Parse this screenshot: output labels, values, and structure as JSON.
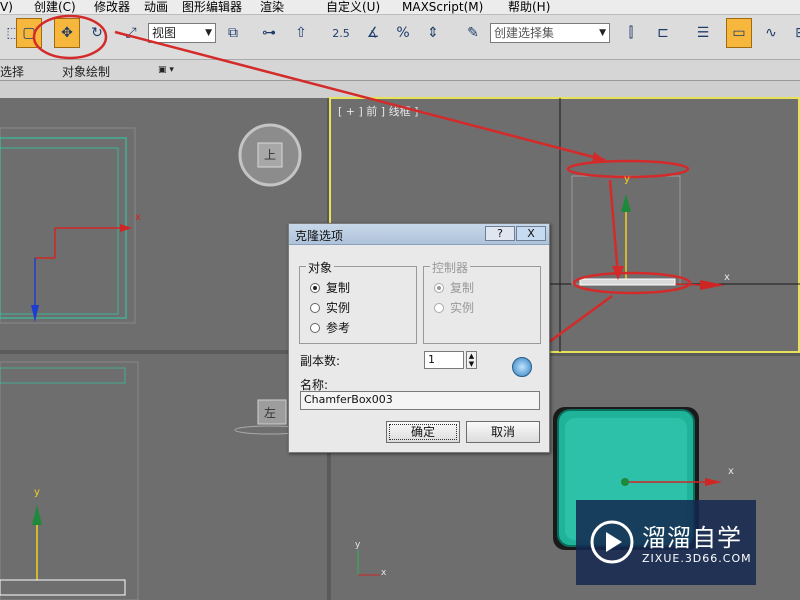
{
  "menu": {
    "items": [
      "V)",
      "创建(C)",
      "修改器",
      "动画",
      "图形编辑器",
      "渲染",
      "自定义(U)",
      "MAXScript(M)",
      "帮助(H)"
    ]
  },
  "toolbar": {
    "view_select": "视图",
    "snap_label": "2.5",
    "selection_set_placeholder": "创建选择集"
  },
  "ribbon": {
    "select_label": "选择",
    "object_paint_label": "对象绘制"
  },
  "viewports": {
    "top_right_label": "[ + ] 前 ] 线框 ]",
    "viewcube_top": "上",
    "viewcube_left": "左",
    "axis_x": "x",
    "axis_y": "y"
  },
  "dialog": {
    "title": "克隆选项",
    "help_btn": "?",
    "close_btn": "X",
    "object_group": "对象",
    "object_options": [
      "复制",
      "实例",
      "参考"
    ],
    "object_selected": 0,
    "controller_group": "控制器",
    "controller_options": [
      "复制",
      "实例"
    ],
    "controller_selected": 0,
    "copies_label": "副本数:",
    "copies_value": "1",
    "name_label": "名称:",
    "name_value": "ChamferBox003",
    "ok_label": "确定",
    "cancel_label": "取消"
  },
  "watermark": {
    "brand": "溜溜自学",
    "url": "ZIXUE.3D66.COM"
  },
  "colors": {
    "annotation_red": "#d42a2a",
    "viewport_highlight": "#e8e25a",
    "object_teal": "#1fb39a"
  }
}
